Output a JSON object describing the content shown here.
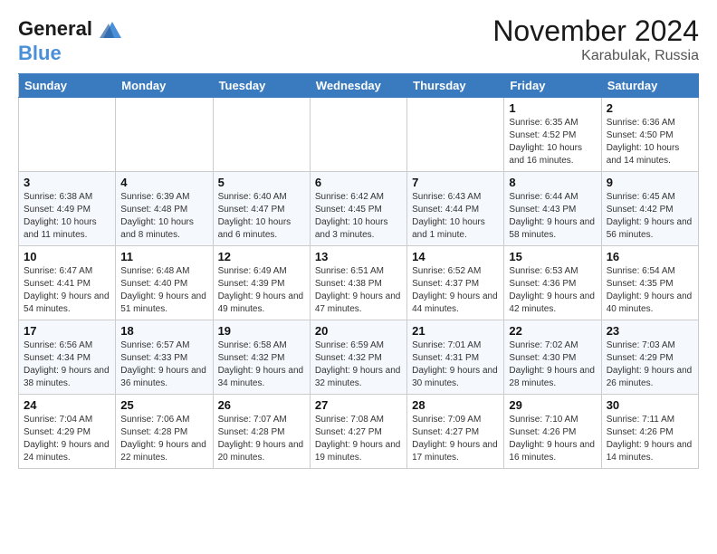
{
  "header": {
    "logo_line1": "General",
    "logo_line2": "Blue",
    "month": "November 2024",
    "location": "Karabulak, Russia"
  },
  "days_of_week": [
    "Sunday",
    "Monday",
    "Tuesday",
    "Wednesday",
    "Thursday",
    "Friday",
    "Saturday"
  ],
  "weeks": [
    [
      {
        "day": "",
        "info": ""
      },
      {
        "day": "",
        "info": ""
      },
      {
        "day": "",
        "info": ""
      },
      {
        "day": "",
        "info": ""
      },
      {
        "day": "",
        "info": ""
      },
      {
        "day": "1",
        "info": "Sunrise: 6:35 AM\nSunset: 4:52 PM\nDaylight: 10 hours and 16 minutes."
      },
      {
        "day": "2",
        "info": "Sunrise: 6:36 AM\nSunset: 4:50 PM\nDaylight: 10 hours and 14 minutes."
      }
    ],
    [
      {
        "day": "3",
        "info": "Sunrise: 6:38 AM\nSunset: 4:49 PM\nDaylight: 10 hours and 11 minutes."
      },
      {
        "day": "4",
        "info": "Sunrise: 6:39 AM\nSunset: 4:48 PM\nDaylight: 10 hours and 8 minutes."
      },
      {
        "day": "5",
        "info": "Sunrise: 6:40 AM\nSunset: 4:47 PM\nDaylight: 10 hours and 6 minutes."
      },
      {
        "day": "6",
        "info": "Sunrise: 6:42 AM\nSunset: 4:45 PM\nDaylight: 10 hours and 3 minutes."
      },
      {
        "day": "7",
        "info": "Sunrise: 6:43 AM\nSunset: 4:44 PM\nDaylight: 10 hours and 1 minute."
      },
      {
        "day": "8",
        "info": "Sunrise: 6:44 AM\nSunset: 4:43 PM\nDaylight: 9 hours and 58 minutes."
      },
      {
        "day": "9",
        "info": "Sunrise: 6:45 AM\nSunset: 4:42 PM\nDaylight: 9 hours and 56 minutes."
      }
    ],
    [
      {
        "day": "10",
        "info": "Sunrise: 6:47 AM\nSunset: 4:41 PM\nDaylight: 9 hours and 54 minutes."
      },
      {
        "day": "11",
        "info": "Sunrise: 6:48 AM\nSunset: 4:40 PM\nDaylight: 9 hours and 51 minutes."
      },
      {
        "day": "12",
        "info": "Sunrise: 6:49 AM\nSunset: 4:39 PM\nDaylight: 9 hours and 49 minutes."
      },
      {
        "day": "13",
        "info": "Sunrise: 6:51 AM\nSunset: 4:38 PM\nDaylight: 9 hours and 47 minutes."
      },
      {
        "day": "14",
        "info": "Sunrise: 6:52 AM\nSunset: 4:37 PM\nDaylight: 9 hours and 44 minutes."
      },
      {
        "day": "15",
        "info": "Sunrise: 6:53 AM\nSunset: 4:36 PM\nDaylight: 9 hours and 42 minutes."
      },
      {
        "day": "16",
        "info": "Sunrise: 6:54 AM\nSunset: 4:35 PM\nDaylight: 9 hours and 40 minutes."
      }
    ],
    [
      {
        "day": "17",
        "info": "Sunrise: 6:56 AM\nSunset: 4:34 PM\nDaylight: 9 hours and 38 minutes."
      },
      {
        "day": "18",
        "info": "Sunrise: 6:57 AM\nSunset: 4:33 PM\nDaylight: 9 hours and 36 minutes."
      },
      {
        "day": "19",
        "info": "Sunrise: 6:58 AM\nSunset: 4:32 PM\nDaylight: 9 hours and 34 minutes."
      },
      {
        "day": "20",
        "info": "Sunrise: 6:59 AM\nSunset: 4:32 PM\nDaylight: 9 hours and 32 minutes."
      },
      {
        "day": "21",
        "info": "Sunrise: 7:01 AM\nSunset: 4:31 PM\nDaylight: 9 hours and 30 minutes."
      },
      {
        "day": "22",
        "info": "Sunrise: 7:02 AM\nSunset: 4:30 PM\nDaylight: 9 hours and 28 minutes."
      },
      {
        "day": "23",
        "info": "Sunrise: 7:03 AM\nSunset: 4:29 PM\nDaylight: 9 hours and 26 minutes."
      }
    ],
    [
      {
        "day": "24",
        "info": "Sunrise: 7:04 AM\nSunset: 4:29 PM\nDaylight: 9 hours and 24 minutes."
      },
      {
        "day": "25",
        "info": "Sunrise: 7:06 AM\nSunset: 4:28 PM\nDaylight: 9 hours and 22 minutes."
      },
      {
        "day": "26",
        "info": "Sunrise: 7:07 AM\nSunset: 4:28 PM\nDaylight: 9 hours and 20 minutes."
      },
      {
        "day": "27",
        "info": "Sunrise: 7:08 AM\nSunset: 4:27 PM\nDaylight: 9 hours and 19 minutes."
      },
      {
        "day": "28",
        "info": "Sunrise: 7:09 AM\nSunset: 4:27 PM\nDaylight: 9 hours and 17 minutes."
      },
      {
        "day": "29",
        "info": "Sunrise: 7:10 AM\nSunset: 4:26 PM\nDaylight: 9 hours and 16 minutes."
      },
      {
        "day": "30",
        "info": "Sunrise: 7:11 AM\nSunset: 4:26 PM\nDaylight: 9 hours and 14 minutes."
      }
    ]
  ]
}
